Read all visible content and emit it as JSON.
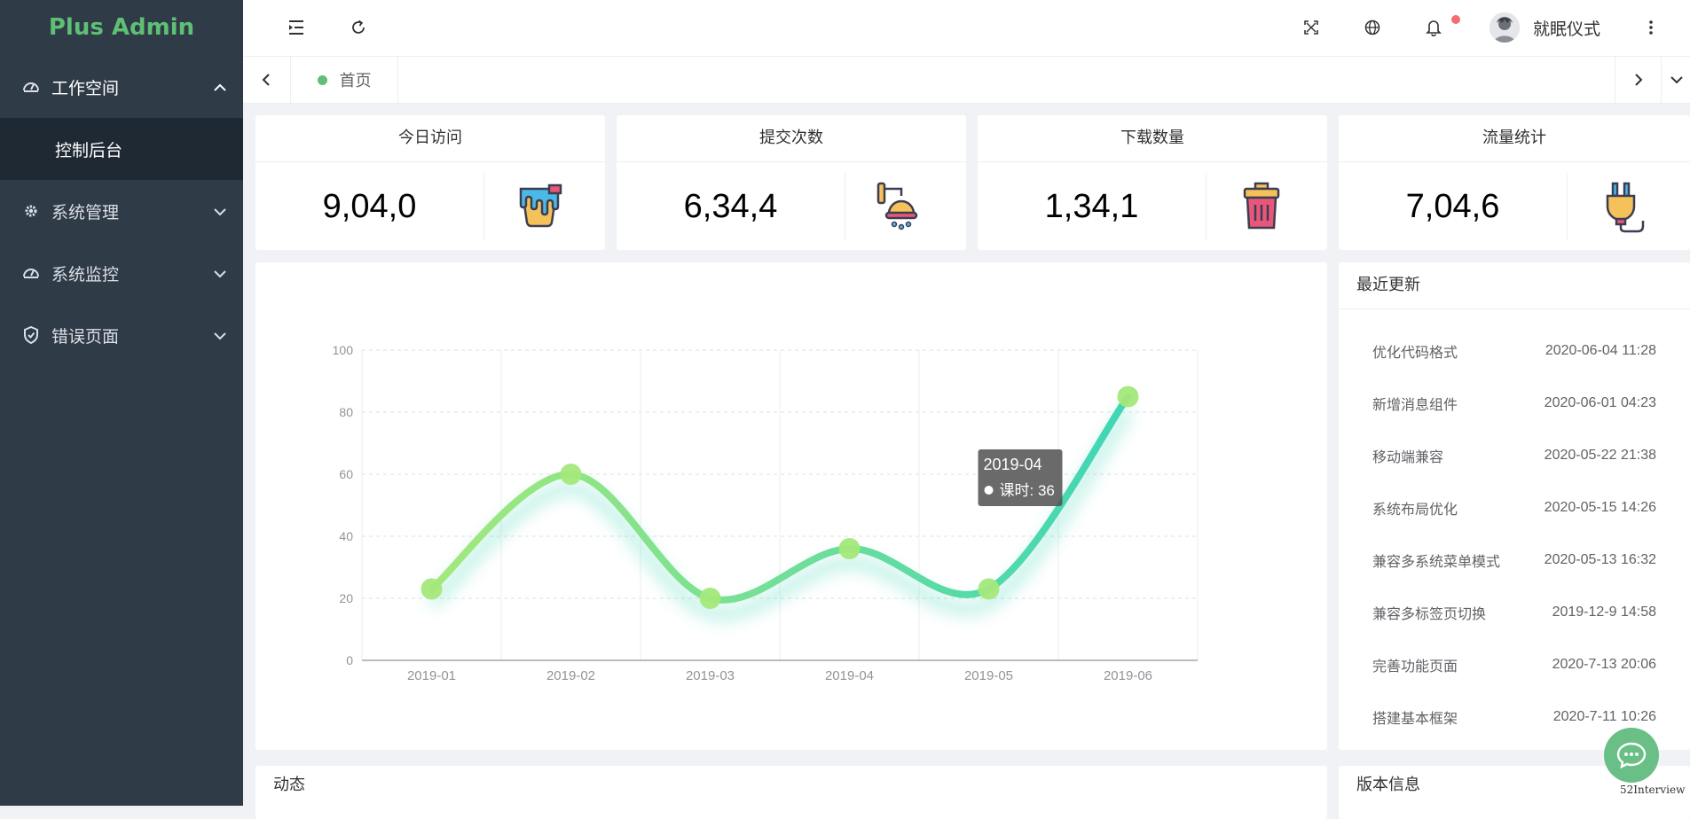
{
  "app": {
    "title": "Plus Admin"
  },
  "sidebar": {
    "items": [
      {
        "label": "工作空间",
        "icon": "dashboard-icon",
        "expanded": true,
        "children": [
          {
            "label": "控制后台"
          }
        ]
      },
      {
        "label": "系统管理",
        "icon": "gear-icon",
        "expanded": false
      },
      {
        "label": "系统监控",
        "icon": "dashboard-icon",
        "expanded": false
      },
      {
        "label": "错误页面",
        "icon": "shield-icon",
        "expanded": false
      }
    ]
  },
  "header": {
    "icons": [
      "menu-fold-icon",
      "refresh-icon",
      "fullscreen-icon",
      "globe-icon",
      "bell-icon",
      "more-vertical-icon"
    ],
    "username": "就眠仪式",
    "notification_dot_color": "#f56c6c"
  },
  "tabs": [
    {
      "label": "首页",
      "active": true
    }
  ],
  "stats": [
    {
      "title": "今日访问",
      "value": "9,04,0",
      "icon": "paint-bucket-icon"
    },
    {
      "title": "提交次数",
      "value": "6,34,4",
      "icon": "shower-icon"
    },
    {
      "title": "下载数量",
      "value": "1,34,1",
      "icon": "trash-can-icon"
    },
    {
      "title": "流量统计",
      "value": "7,04,6",
      "icon": "power-plug-icon"
    }
  ],
  "chart_data": {
    "type": "line",
    "categories": [
      "2019-01",
      "2019-02",
      "2019-03",
      "2019-04",
      "2019-05",
      "2019-06"
    ],
    "series": [
      {
        "name": "课时",
        "values": [
          23,
          60,
          20,
          36,
          23,
          85
        ]
      }
    ],
    "ylim": [
      0,
      100
    ],
    "yticks": [
      0,
      20,
      40,
      60,
      80,
      100
    ],
    "smooth": true,
    "grid": true,
    "tooltip": {
      "category": "2019-04",
      "label": "课时: 36"
    },
    "colors": {
      "start": "#a4e87a",
      "end": "#3fd6b6"
    }
  },
  "updates": {
    "title": "最近更新",
    "items": [
      {
        "text": "优化代码格式",
        "date": "2020-06-04 11:28"
      },
      {
        "text": "新增消息组件",
        "date": "2020-06-01 04:23"
      },
      {
        "text": "移动端兼容",
        "date": "2020-05-22 21:38"
      },
      {
        "text": "系统布局优化",
        "date": "2020-05-15 14:26"
      },
      {
        "text": "兼容多系统菜单模式",
        "date": "2020-05-13 16:32"
      },
      {
        "text": "兼容多标签页切换",
        "date": "2019-12-9 14:58"
      },
      {
        "text": "完善功能页面",
        "date": "2020-7-13 20:06"
      },
      {
        "text": "搭建基本框架",
        "date": "2020-7-11 10:26"
      }
    ]
  },
  "bottom": {
    "dynamic_title": "动态",
    "version_title": "版本信息"
  },
  "watermark": "52Interview",
  "colors": {
    "sidebar": "#2f3b47",
    "accent": "#5fbf74"
  }
}
